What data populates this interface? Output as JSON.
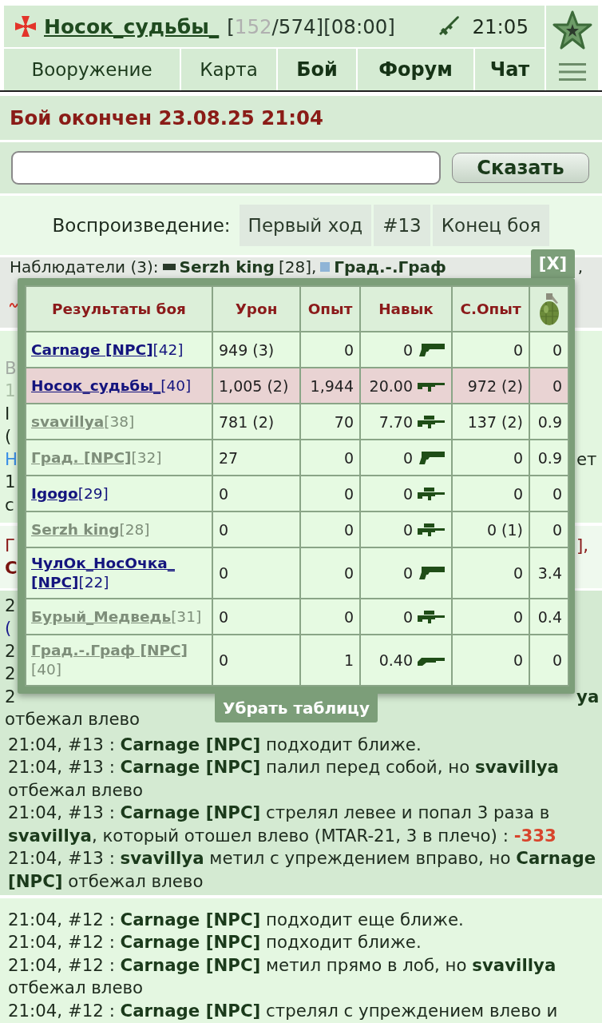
{
  "header": {
    "player": "Носок_судьбы_",
    "stats": [
      {
        "text": "[",
        "muted": false
      },
      {
        "text": "152",
        "muted": true
      },
      {
        "text": "/574][08:00]",
        "muted": false
      }
    ],
    "time": "21:05"
  },
  "nav": {
    "tabs": [
      {
        "label": "Вооружение",
        "emphasized": false
      },
      {
        "label": "Карта",
        "emphasized": false
      },
      {
        "label": "Бой",
        "emphasized": true
      },
      {
        "label": "Форум",
        "emphasized": true
      },
      {
        "label": "Чат",
        "emphasized": true
      }
    ]
  },
  "battle_status": "Бой окончен 23.08.25 21:04",
  "say_form": {
    "button": "Сказать"
  },
  "playback": {
    "label": "Воспроизведение:",
    "buttons": [
      "Первый ход",
      "#13",
      "Конец боя"
    ]
  },
  "observers": {
    "label": "Наблюдатели (3):",
    "people": [
      {
        "name": "Serzh king",
        "suffix": "[28],"
      },
      {
        "name": "Град.-.Граф"
      }
    ],
    "tail": ","
  },
  "battle_info": {
    "lines": [
      {
        "left": {
          "text": "В",
          "kind": "muted"
        }
      },
      {
        "left": {
          "text": "1",
          "kind": "pale"
        }
      },
      {
        "left": {
          "text": "I",
          "kind": "plain"
        }
      },
      {
        "left": {
          "text": "(",
          "kind": "plain"
        }
      },
      {
        "left": {
          "text": "Н",
          "kind": "link"
        },
        "right": {
          "text": "ет",
          "kind": "plain"
        }
      },
      {
        "left": {
          "text": "1",
          "kind": "plain"
        }
      },
      {
        "left": {
          "text": "с",
          "kind": "plain"
        }
      }
    ]
  },
  "teams": {
    "lines": [
      {
        "left": {
          "text": "Г",
          "kind": "red"
        },
        "right": {
          "text": "],",
          "kind": "red"
        }
      },
      {
        "left": {
          "text": "С",
          "kind": "red_bold"
        }
      }
    ]
  },
  "results": {
    "columns": [
      {
        "label": "Результаты боя"
      },
      {
        "label": "Урон"
      },
      {
        "label": "Опыт"
      },
      {
        "label": "Навык"
      },
      {
        "label": "С.Опыт"
      }
    ],
    "rows": [
      {
        "player": "**Carnage [NPC]**[42]",
        "color": "#14147e",
        "highlighted": false,
        "damage": "949 (3)",
        "exp": "0",
        "skill": "0",
        "kind": "pistol",
        "team_exp": "0",
        "grenade": "0"
      },
      {
        "player": "**Носок_судьбы_**[40]",
        "color": "#14147e",
        "highlighted": true,
        "damage": "1,005 (2)",
        "exp": "1,944",
        "skill": "20.00",
        "kind": "machine_gun",
        "team_exp": "972 (2)",
        "grenade": "0"
      },
      {
        "player": "**svavillya**[38]",
        "color": "#7e8e7a",
        "highlighted": false,
        "damage": "781 (2)",
        "exp": "70",
        "skill": "7.70",
        "kind": "rifle",
        "team_exp": "137 (2)",
        "grenade": "0.9"
      },
      {
        "player": "**Град. [NPC]**[32]",
        "color": "#7e8e7a",
        "highlighted": false,
        "damage": "27",
        "exp": "0",
        "skill": "0",
        "kind": "pistol",
        "team_exp": "0",
        "grenade": "0.9"
      },
      {
        "player": "**Igogo**[29]",
        "color": "#14147e",
        "highlighted": false,
        "damage": "0",
        "exp": "0",
        "skill": "0",
        "kind": "rifle",
        "team_exp": "0",
        "grenade": "0"
      },
      {
        "player": "**Serzh king**[28]",
        "color": "#7e8e7a",
        "highlighted": false,
        "damage": "0",
        "exp": "0",
        "skill": "0",
        "kind": "rifle",
        "team_exp": "0 (1)",
        "grenade": "0"
      },
      {
        "player": "**ЧулОк_НосОчка_ [NPC]**[22]",
        "color": "#14147e",
        "highlighted": false,
        "damage": "0",
        "exp": "0",
        "skill": "0",
        "kind": "pistol",
        "team_exp": "0",
        "grenade": "3.4"
      },
      {
        "player": "**Бурый_Медведь**[31]",
        "color": "#7e8e7a",
        "highlighted": false,
        "damage": "0",
        "exp": "0",
        "skill": "0",
        "kind": "rifle",
        "team_exp": "0",
        "grenade": "0.4"
      },
      {
        "player": "**Град.-.Граф [NPC]**[40]",
        "color": "#7e8e7a",
        "highlighted": false,
        "damage": "0",
        "exp": "1",
        "skill": "0.40",
        "kind": "shotgun",
        "team_exp": "0",
        "grenade": "0"
      }
    ],
    "close": "[X]",
    "hide": "Убрать таблицу"
  },
  "log": [
    {
      "covered": [
        {
          "left": {
            "text": "2",
            "kind": "plain"
          }
        },
        {
          "left": {
            "text": "(",
            "kind": "navy"
          }
        },
        {
          "left": {
            "text": "2",
            "kind": "plain"
          }
        },
        {
          "left": {
            "text": "2",
            "kind": "plain"
          }
        },
        {
          "left": {
            "text": "2",
            "kind": "plain"
          },
          "right": {
            "text": "уа",
            "kind": "name"
          }
        },
        {
          "left": {
            "text": "отбежал влево",
            "kind": "plain"
          }
        }
      ],
      "entries": [
        {
          "segments": [
            {
              "text": "21:04, #13 : ",
              "kind": "plain"
            },
            {
              "text": "Carnage [NPC]",
              "kind": "name"
            },
            {
              "text": " подходит ближе.",
              "kind": "plain"
            }
          ]
        },
        {
          "segments": [
            {
              "text": "21:04, #13 : ",
              "kind": "plain"
            },
            {
              "text": "Carnage [NPC]",
              "kind": "name"
            },
            {
              "text": " палил перед собой, но ",
              "kind": "plain"
            },
            {
              "text": "svavillya",
              "kind": "name"
            },
            {
              "text": " отбежал влево",
              "kind": "plain"
            }
          ]
        },
        {
          "segments": [
            {
              "text": "21:04, #13 : ",
              "kind": "plain"
            },
            {
              "text": "Carnage [NPC]",
              "kind": "name"
            },
            {
              "text": " стрелял левее и попал 3 раза в ",
              "kind": "plain"
            },
            {
              "text": "svavillya",
              "kind": "name"
            },
            {
              "text": ", который отошел влево (MTAR-21, 3 в плечо) : ",
              "kind": "plain"
            },
            {
              "text": "-333",
              "kind": "damage"
            }
          ]
        },
        {
          "segments": [
            {
              "text": "21:04, #13 : ",
              "kind": "plain"
            },
            {
              "text": "svavillya",
              "kind": "name"
            },
            {
              "text": " метил с упреждением вправо, но ",
              "kind": "plain"
            },
            {
              "text": "Carnage [NPC]",
              "kind": "name"
            },
            {
              "text": " отбежал влево",
              "kind": "plain"
            }
          ]
        }
      ]
    },
    {
      "entries": [
        {
          "segments": [
            {
              "text": "21:04, #12 : ",
              "kind": "plain"
            },
            {
              "text": "Carnage [NPC]",
              "kind": "name"
            },
            {
              "text": " подходит еще ближе.",
              "kind": "plain"
            }
          ]
        },
        {
          "segments": [
            {
              "text": "21:04, #12 : ",
              "kind": "plain"
            },
            {
              "text": "Carnage [NPC]",
              "kind": "name"
            },
            {
              "text": " подходит ближе.",
              "kind": "plain"
            }
          ]
        },
        {
          "segments": [
            {
              "text": "21:04, #12 : ",
              "kind": "plain"
            },
            {
              "text": "Carnage [NPC]",
              "kind": "name"
            },
            {
              "text": " метил прямо в лоб, но ",
              "kind": "plain"
            },
            {
              "text": "svavillya",
              "kind": "name"
            },
            {
              "text": " отбежал влево",
              "kind": "plain"
            }
          ]
        },
        {
          "segments": [
            {
              "text": "21:04, #12 : ",
              "kind": "plain"
            },
            {
              "text": "Carnage [NPC]",
              "kind": "name"
            },
            {
              "text": " стрелял с упреждением влево и",
              "kind": "plain"
            }
          ]
        }
      ]
    }
  ]
}
